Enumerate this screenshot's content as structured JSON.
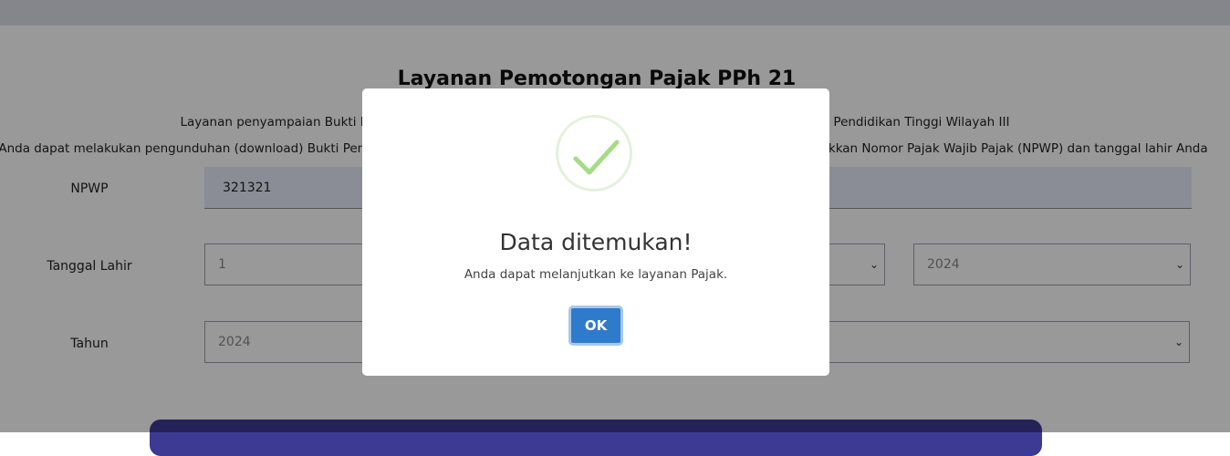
{
  "page": {
    "title": "Layanan Pemotongan Pajak PPh 21",
    "description_line1": "Layanan penyampaian Bukti Pemotongan Pajak PPh 21 secara daring kepada Pegawai Lembaga Layanan Pendidikan Tinggi Wilayah III",
    "description_line2": "Anda dapat melakukan pengunduhan (download) Bukti Pemotongan dan Rekapitulasi Pemotongan Pajak PPh 21 dengan cara memasukkan Nomor Pajak Wajib Pajak (NPWP) dan tanggal lahir Anda"
  },
  "form": {
    "npwp": {
      "label": "NPWP",
      "value": "321321"
    },
    "tanggal_lahir": {
      "label": "Tanggal Lahir",
      "day": "1",
      "month": "",
      "year": "2024"
    },
    "tahun": {
      "label": "Tahun",
      "year": "2024",
      "period": ""
    }
  },
  "icons": {
    "dropdown": "chevron-down-icon",
    "success": "checkmark-icon"
  },
  "colors": {
    "primary_button": "#2f7bcb",
    "submit_bar": "#3c3a93",
    "success": "#a5dc86"
  },
  "modal": {
    "title": "Data ditemukan!",
    "text": "Anda dapat melanjutkan ke layanan Pajak.",
    "ok_label": "OK"
  }
}
